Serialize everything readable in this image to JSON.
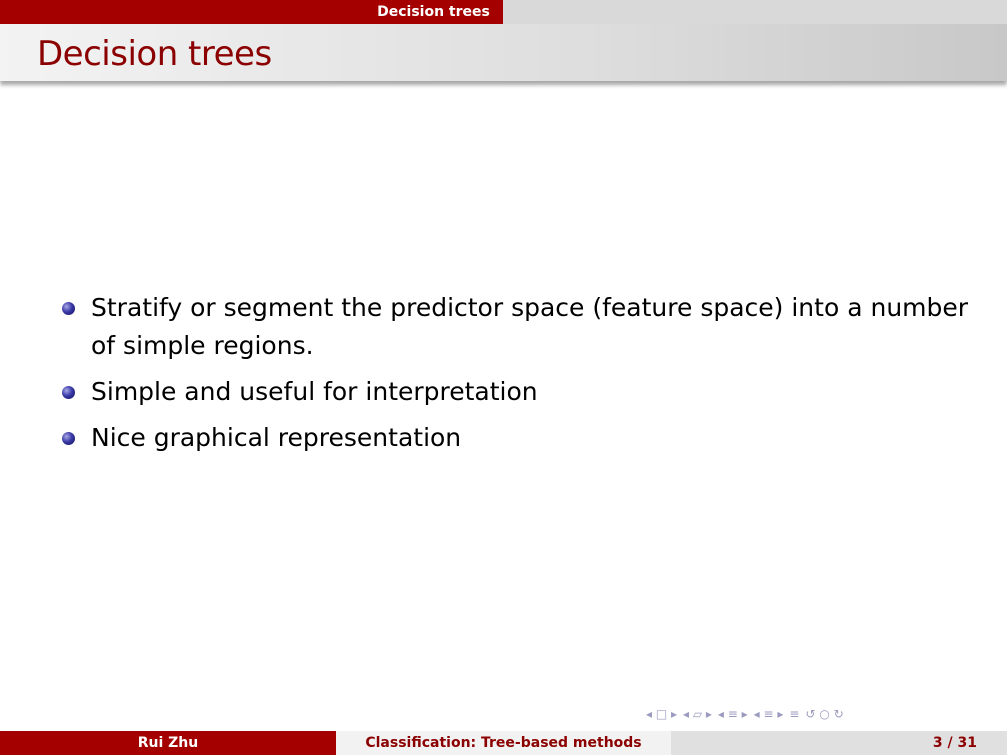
{
  "header": {
    "section_tab": "Decision trees"
  },
  "slide": {
    "title": "Decision trees",
    "bullets": [
      "Stratify or segment the predictor space (feature space) into a number of simple regions.",
      "Simple and useful for interpretation",
      "Nice graphical representation"
    ]
  },
  "footer": {
    "author": "Rui Zhu",
    "title": "Classification: Tree-based methods",
    "page": "3 / 31"
  },
  "nav_icons": [
    "nav-frame-icon",
    "nav-subsection-icon",
    "nav-section-icon",
    "nav-doc-icon",
    "nav-back-icon",
    "nav-search-icon"
  ],
  "colors": {
    "accent": "#a50000",
    "title": "#8b0000",
    "bullet": "#2e2e9e"
  }
}
